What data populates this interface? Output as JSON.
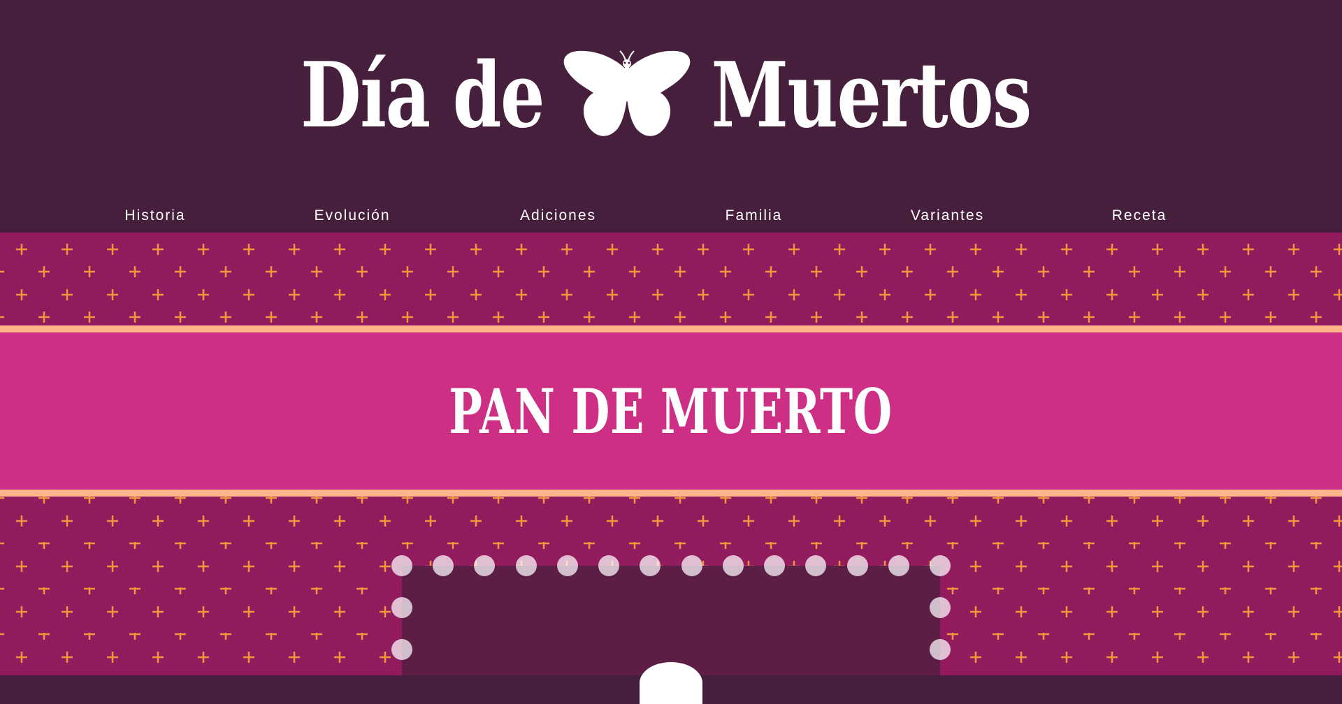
{
  "header": {
    "title_left": "Día de",
    "title_right": "Muertos",
    "logo_icon": "butterfly-icon"
  },
  "nav": {
    "items": [
      {
        "label": "Historia"
      },
      {
        "label": "Evolución"
      },
      {
        "label": "Adiciones"
      },
      {
        "label": "Familia"
      },
      {
        "label": "Variantes"
      },
      {
        "label": "Receta"
      }
    ]
  },
  "banner": {
    "title": "PAN DE MUERTO"
  },
  "colors": {
    "header_bg": "#461f3d",
    "pattern_bg": "#921b5e",
    "pattern_cross": "#f0973c",
    "band_bg": "#cc2f83",
    "band_border": "#ffb48c",
    "frame_bg": "#5c1e44"
  }
}
